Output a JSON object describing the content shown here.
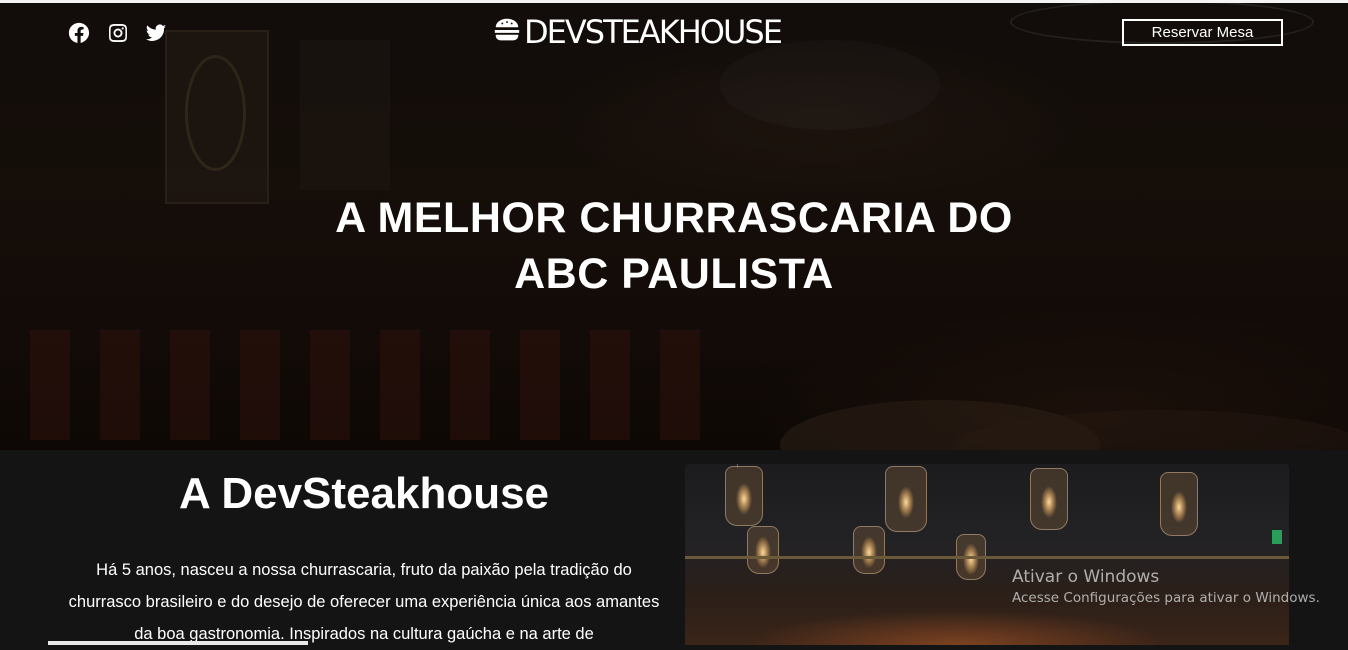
{
  "header": {
    "social": [
      {
        "name": "facebook",
        "icon": "facebook-icon"
      },
      {
        "name": "instagram",
        "icon": "instagram-icon"
      },
      {
        "name": "twitter",
        "icon": "twitter-icon"
      }
    ],
    "logo_icon": "burger-icon",
    "logo_text": "DEVSTEAKHOUSE",
    "reserve_label": "Reservar Mesa"
  },
  "hero": {
    "title_line1": "A MELHOR CHURRASCARIA DO",
    "title_line2": "ABC PAULISTA"
  },
  "about": {
    "title": "A DevSteakhouse",
    "text": "Há 5 anos, nasceu a nossa churrascaria, fruto da paixão pela tradição do churrasco brasileiro e do desejo de oferecer uma experiência única aos amantes da boa gastronomia. Inspirados na cultura gaúcha e na arte de"
  },
  "watermark": {
    "title": "Ativar o Windows",
    "subtitle": "Acesse Configurações para ativar o Windows."
  },
  "colors": {
    "background": "#141414",
    "text": "#ffffff"
  }
}
